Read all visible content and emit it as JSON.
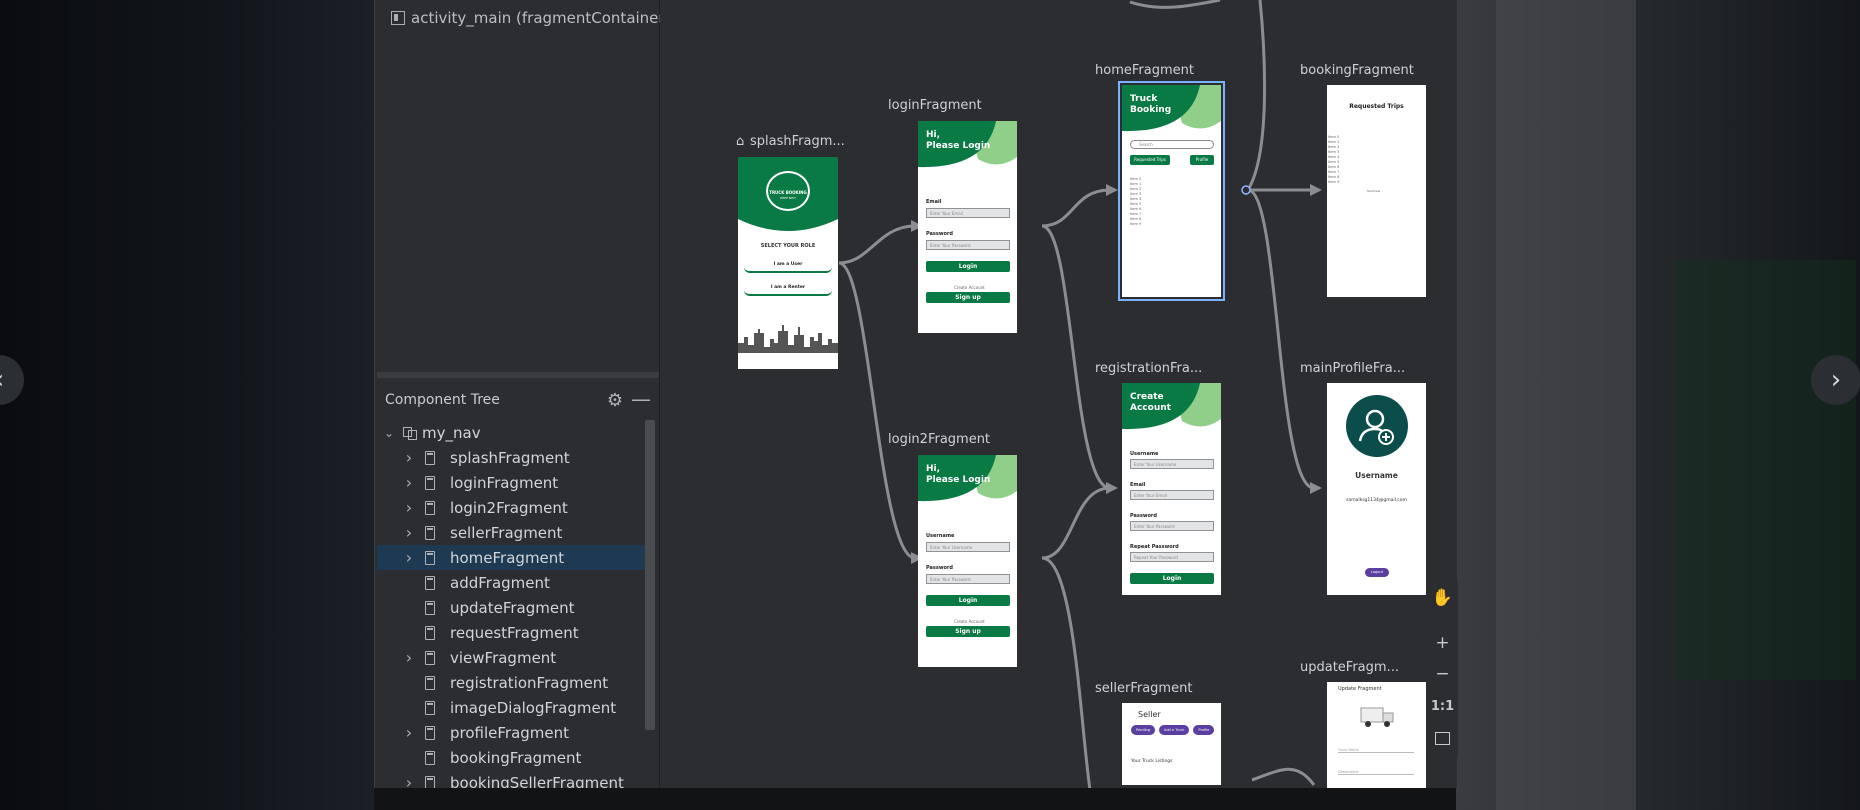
{
  "window": {
    "title": "activity_main (fragmentContainerView"
  },
  "component_tree": {
    "title": "Component Tree",
    "root": "my_nav",
    "items": [
      {
        "label": "splashFragment",
        "expandable": true,
        "selected": false
      },
      {
        "label": "loginFragment",
        "expandable": true,
        "selected": false
      },
      {
        "label": "login2Fragment",
        "expandable": true,
        "selected": false
      },
      {
        "label": "sellerFragment",
        "expandable": true,
        "selected": false
      },
      {
        "label": "homeFragment",
        "expandable": true,
        "selected": true
      },
      {
        "label": "addFragment",
        "expandable": false,
        "selected": false
      },
      {
        "label": "updateFragment",
        "expandable": false,
        "selected": false
      },
      {
        "label": "requestFragment",
        "expandable": false,
        "selected": false
      },
      {
        "label": "viewFragment",
        "expandable": true,
        "selected": false
      },
      {
        "label": "registrationFragment",
        "expandable": false,
        "selected": false
      },
      {
        "label": "imageDialogFragment",
        "expandable": false,
        "selected": false
      },
      {
        "label": "profileFragment",
        "expandable": true,
        "selected": false
      },
      {
        "label": "bookingFragment",
        "expandable": false,
        "selected": false
      },
      {
        "label": "bookingSellerFragment",
        "expandable": true,
        "selected": false
      }
    ]
  },
  "nav_graph": {
    "splash": {
      "label": "splashFragm...",
      "logo_text": "TRUCK BOOKING",
      "logo_sub": "DEEP BHIT",
      "role_label": "SELECT YOUR ROLE",
      "btn_user": "I am a User",
      "btn_renter": "I am a Renter"
    },
    "login": {
      "label": "loginFragment",
      "heading": "Hi,\nPlease Login",
      "email_label": "Email",
      "email_placeholder": "Enter Your Email",
      "password_label": "Password",
      "password_placeholder": "Enter Your Password",
      "login_btn": "Login",
      "create_label": "Create Account",
      "signup_btn": "Sign up"
    },
    "login2": {
      "label": "login2Fragment",
      "heading": "Hi,\nPlease Login",
      "username_label": "Username",
      "username_placeholder": "Enter Your Username",
      "password_label": "Password",
      "password_placeholder": "Enter Your Password",
      "login_btn": "Login",
      "create_label": "Create Account",
      "signup_btn": "Sign up"
    },
    "home": {
      "label": "homeFragment",
      "heading": "Truck\nBooking",
      "search_placeholder": "Search",
      "btn_requested": "Requested Trips",
      "btn_profile": "Profile",
      "list_items": [
        "Item 0",
        "Item 1",
        "Item 2",
        "Item 3",
        "Item 4",
        "Item 5",
        "Item 6",
        "Item 7",
        "Item 8",
        "Item 9"
      ]
    },
    "booking": {
      "label": "bookingFragment",
      "heading": "Requested Trips",
      "list_items": [
        "Item 0",
        "Item 1",
        "Item 2",
        "Item 3",
        "Item 4",
        "Item 5",
        "Item 6",
        "Item 7",
        "Item 8",
        "Item 9"
      ],
      "center_text": "TextView"
    },
    "registration": {
      "label": "registrationFra...",
      "heading": "Create\nAccount",
      "username_label": "Username",
      "username_placeholder": "Enter Your Username",
      "email_label": "Email",
      "email_placeholder": "Enter Your Email",
      "password_label": "Password",
      "password_placeholder": "Enter Your Password",
      "repeat_label": "Repeat Password",
      "repeat_placeholder": "Repeat Your Password",
      "login_btn": "Login"
    },
    "main_profile": {
      "label": "mainProfileFra...",
      "username": "Username",
      "email": "samalksg1134@gmail.com",
      "logout_btn": "Logout"
    },
    "seller": {
      "label": "sellerFragment",
      "heading": "Seller",
      "chips": [
        "Pending",
        "Add a Truck",
        "Profile"
      ],
      "listings_label": "Your Truck Listings"
    },
    "update": {
      "label": "updateFragm...",
      "heading": "Update Fragment",
      "field1": "Truck Name",
      "field2": "Dimensions"
    }
  },
  "toolbar": {
    "pan": "pan-hand",
    "zoom_in": "+",
    "zoom_out": "−",
    "actual_size": "1:1",
    "fit": "fit-screen"
  },
  "colors": {
    "accent_green": "#0a7a45",
    "light_green": "#8fcf8a",
    "selection_blue": "#7ab2ff",
    "tree_selected": "#1e3a52",
    "profile_purple": "#5b3fa0"
  }
}
